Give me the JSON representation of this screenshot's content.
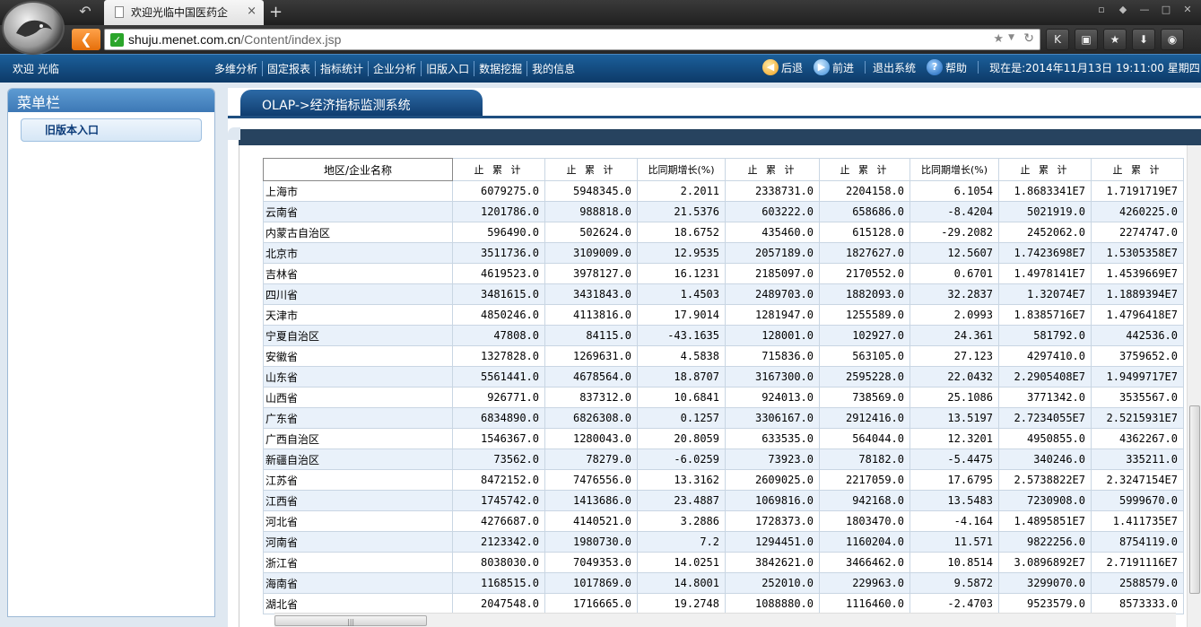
{
  "browser": {
    "tab_title": "欢迎光临中国医药企",
    "tab_close": "×",
    "new_tab": "+",
    "url_domain": "shuju.menet.com.cn",
    "url_path": "/Content/index.jsp",
    "icons": [
      "back-icon",
      "new-tab-icon",
      "secure-check-icon",
      "star-icon",
      "reload-icon",
      "k-icon",
      "lock-icon",
      "favorites-icon",
      "download-icon",
      "gamepad-icon"
    ]
  },
  "header": {
    "welcome": "欢迎 光临",
    "menu": [
      "多维分析",
      "固定报表",
      "指标统计",
      "企业分析",
      "旧版入口",
      "数据挖掘",
      "我的信息"
    ],
    "back_label": "后退",
    "forward_label": "前进",
    "logout_label": "退出系统",
    "help_label": "帮助",
    "clock": "现在是:2014年11月13日 19:11:00 星期四"
  },
  "sidebar": {
    "title": "菜单栏",
    "entry": "旧版本入口"
  },
  "main": {
    "breadcrumb": "OLAP->经济指标监测系统"
  },
  "table": {
    "headers": [
      "地区/企业名称",
      "止 累 计",
      "止 累 计",
      "比同期增长(%)",
      "止 累 计",
      "止 累 计",
      "比同期增长(%)",
      "止 累 计",
      "止 累 计"
    ],
    "rows": [
      [
        "上海市",
        "6079275.0",
        "5948345.0",
        "2.2011",
        "2338731.0",
        "2204158.0",
        "6.1054",
        "1.8683341E7",
        "1.7191719E7"
      ],
      [
        "云南省",
        "1201786.0",
        "988818.0",
        "21.5376",
        "603222.0",
        "658686.0",
        "-8.4204",
        "5021919.0",
        "4260225.0"
      ],
      [
        "内蒙古自治区",
        "596490.0",
        "502624.0",
        "18.6752",
        "435460.0",
        "615128.0",
        "-29.2082",
        "2452062.0",
        "2274747.0"
      ],
      [
        "北京市",
        "3511736.0",
        "3109009.0",
        "12.9535",
        "2057189.0",
        "1827627.0",
        "12.5607",
        "1.7423698E7",
        "1.5305358E7"
      ],
      [
        "吉林省",
        "4619523.0",
        "3978127.0",
        "16.1231",
        "2185097.0",
        "2170552.0",
        "0.6701",
        "1.4978141E7",
        "1.4539669E7"
      ],
      [
        "四川省",
        "3481615.0",
        "3431843.0",
        "1.4503",
        "2489703.0",
        "1882093.0",
        "32.2837",
        "1.32074E7",
        "1.1889394E7"
      ],
      [
        "天津市",
        "4850246.0",
        "4113816.0",
        "17.9014",
        "1281947.0",
        "1255589.0",
        "2.0993",
        "1.8385716E7",
        "1.4796418E7"
      ],
      [
        "宁夏自治区",
        "47808.0",
        "84115.0",
        "-43.1635",
        "128001.0",
        "102927.0",
        "24.361",
        "581792.0",
        "442536.0"
      ],
      [
        "安徽省",
        "1327828.0",
        "1269631.0",
        "4.5838",
        "715836.0",
        "563105.0",
        "27.123",
        "4297410.0",
        "3759652.0"
      ],
      [
        "山东省",
        "5561441.0",
        "4678564.0",
        "18.8707",
        "3167300.0",
        "2595228.0",
        "22.0432",
        "2.2905408E7",
        "1.9499717E7"
      ],
      [
        "山西省",
        "926771.0",
        "837312.0",
        "10.6841",
        "924013.0",
        "738569.0",
        "25.1086",
        "3771342.0",
        "3535567.0"
      ],
      [
        "广东省",
        "6834890.0",
        "6826308.0",
        "0.1257",
        "3306167.0",
        "2912416.0",
        "13.5197",
        "2.7234055E7",
        "2.5215931E7"
      ],
      [
        "广西自治区",
        "1546367.0",
        "1280043.0",
        "20.8059",
        "633535.0",
        "564044.0",
        "12.3201",
        "4950855.0",
        "4362267.0"
      ],
      [
        "新疆自治区",
        "73562.0",
        "78279.0",
        "-6.0259",
        "73923.0",
        "78182.0",
        "-5.4475",
        "340246.0",
        "335211.0"
      ],
      [
        "江苏省",
        "8472152.0",
        "7476556.0",
        "13.3162",
        "2609025.0",
        "2217059.0",
        "17.6795",
        "2.5738822E7",
        "2.3247154E7"
      ],
      [
        "江西省",
        "1745742.0",
        "1413686.0",
        "23.4887",
        "1069816.0",
        "942168.0",
        "13.5483",
        "7230908.0",
        "5999670.0"
      ],
      [
        "河北省",
        "4276687.0",
        "4140521.0",
        "3.2886",
        "1728373.0",
        "1803470.0",
        "-4.164",
        "1.4895851E7",
        "1.411735E7"
      ],
      [
        "河南省",
        "2123342.0",
        "1980730.0",
        "7.2",
        "1294451.0",
        "1160204.0",
        "11.571",
        "9822256.0",
        "8754119.0"
      ],
      [
        "浙江省",
        "8038030.0",
        "7049353.0",
        "14.0251",
        "3842621.0",
        "3466462.0",
        "10.8514",
        "3.0896892E7",
        "2.7191116E7"
      ],
      [
        "海南省",
        "1168515.0",
        "1017869.0",
        "14.8001",
        "252010.0",
        "229963.0",
        "9.5872",
        "3299070.0",
        "2588579.0"
      ],
      [
        "湖北省",
        "2047548.0",
        "1716665.0",
        "19.2748",
        "1088880.0",
        "1116460.0",
        "-2.4703",
        "9523579.0",
        "8573333.0"
      ]
    ]
  }
}
